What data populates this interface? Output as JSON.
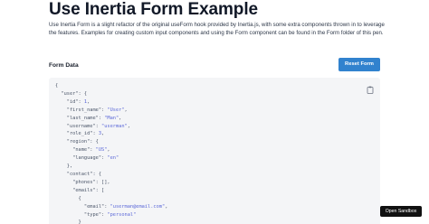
{
  "header": {
    "title": "Use Inertia Form Example",
    "intro": "Use Inertia Form is a slight refactor of the original useForm hook provided by Inertia.js, with some extra components thrown in to leverage the features. Examples for creating custom input components and using the Form component can be found in the Form folder of this pen."
  },
  "form": {
    "section_title": "Form Data",
    "reset_label": "Reset Form"
  },
  "code": {
    "copy_icon": "clipboard-icon",
    "lines": [
      [
        {
          "t": "{"
        }
      ],
      [
        {
          "t": "  \"user\": {"
        }
      ],
      [
        {
          "t": "    \"id\": "
        },
        {
          "t": "1",
          "c": "num"
        },
        {
          "t": ","
        }
      ],
      [
        {
          "t": "    \"first_name\": "
        },
        {
          "t": "\"User\"",
          "c": "str"
        },
        {
          "t": ","
        }
      ],
      [
        {
          "t": "    \"last_name\": "
        },
        {
          "t": "\"Man\"",
          "c": "str"
        },
        {
          "t": ","
        }
      ],
      [
        {
          "t": "    \"username\": "
        },
        {
          "t": "\"userman\"",
          "c": "str"
        },
        {
          "t": ","
        }
      ],
      [
        {
          "t": "    \"role_id\": "
        },
        {
          "t": "3",
          "c": "num"
        },
        {
          "t": ","
        }
      ],
      [
        {
          "t": "    \"region\": {"
        }
      ],
      [
        {
          "t": "      \"name\": "
        },
        {
          "t": "\"US\"",
          "c": "str"
        },
        {
          "t": ","
        }
      ],
      [
        {
          "t": "      \"language\": "
        },
        {
          "t": "\"en\"",
          "c": "str"
        }
      ],
      [
        {
          "t": "    },"
        }
      ],
      [
        {
          "t": "    \"contact\": {"
        }
      ],
      [
        {
          "t": "      \"phones\": [],"
        }
      ],
      [
        {
          "t": "      \"emails\": ["
        }
      ],
      [
        {
          "t": "        {"
        }
      ],
      [
        {
          "t": "          \"email\": "
        },
        {
          "t": "\"userman@email.com\"",
          "c": "str"
        },
        {
          "t": ","
        }
      ],
      [
        {
          "t": "          \"type\": "
        },
        {
          "t": "\"personal\"",
          "c": "str"
        }
      ],
      [
        {
          "t": "        }"
        }
      ]
    ]
  },
  "sandbox": {
    "label": "Open Sandbox"
  },
  "colors": {
    "accent": "#3182ce",
    "code_background": "#f4f5f7",
    "string_value": "#5a67d8"
  }
}
